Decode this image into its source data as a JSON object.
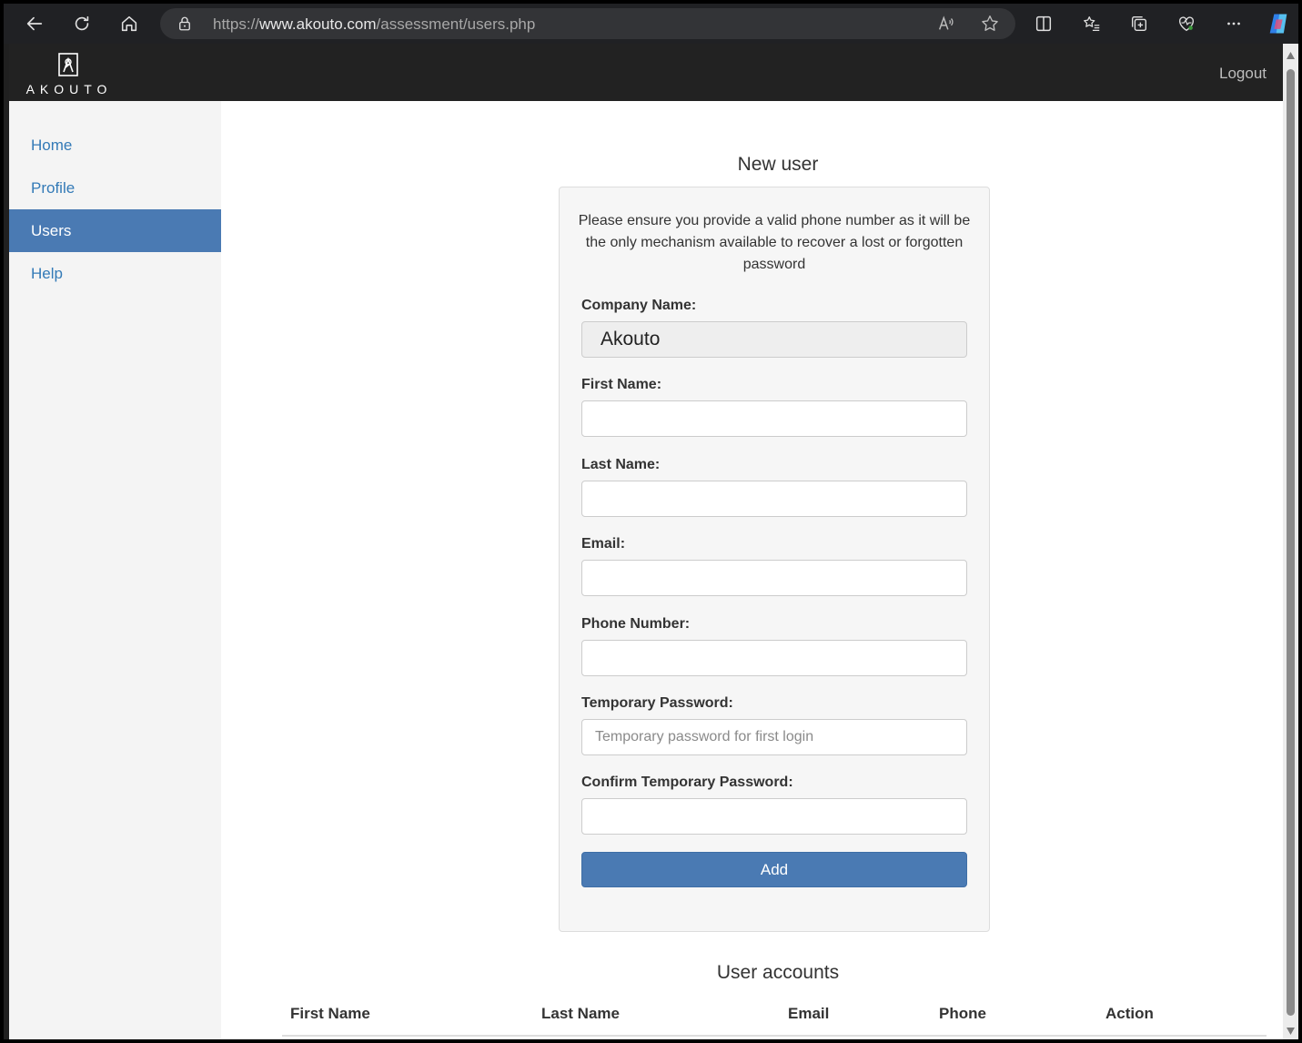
{
  "browser": {
    "url_scheme": "https://",
    "url_host": "www.akouto.com",
    "url_path": "/assessment/users.php"
  },
  "header": {
    "logo_text": "AKOUTO",
    "logout_label": "Logout"
  },
  "sidebar": {
    "items": [
      {
        "label": "Home",
        "active": false
      },
      {
        "label": "Profile",
        "active": false
      },
      {
        "label": "Users",
        "active": true
      },
      {
        "label": "Help",
        "active": false
      }
    ]
  },
  "form": {
    "title": "New user",
    "notice": "Please ensure you provide a valid phone number as it will be the only mechanism available to recover a lost or forgotten password",
    "fields": [
      {
        "label": "Company Name:",
        "value": "Akouto",
        "placeholder": "",
        "readonly": true
      },
      {
        "label": "First Name:",
        "value": "",
        "placeholder": ""
      },
      {
        "label": "Last Name:",
        "value": "",
        "placeholder": ""
      },
      {
        "label": "Email:",
        "value": "",
        "placeholder": ""
      },
      {
        "label": "Phone Number:",
        "value": "",
        "placeholder": ""
      },
      {
        "label": "Temporary Password:",
        "value": "",
        "placeholder": "Temporary password for first login"
      },
      {
        "label": "Confirm Temporary Password:",
        "value": "",
        "placeholder": ""
      }
    ],
    "submit_label": "Add"
  },
  "accounts": {
    "title": "User accounts",
    "columns": [
      "First Name",
      "Last Name",
      "Email",
      "Phone",
      "Action"
    ]
  },
  "colors": {
    "accent": "#4a7ab3",
    "header_bg": "#222222",
    "link": "#337ab7"
  }
}
